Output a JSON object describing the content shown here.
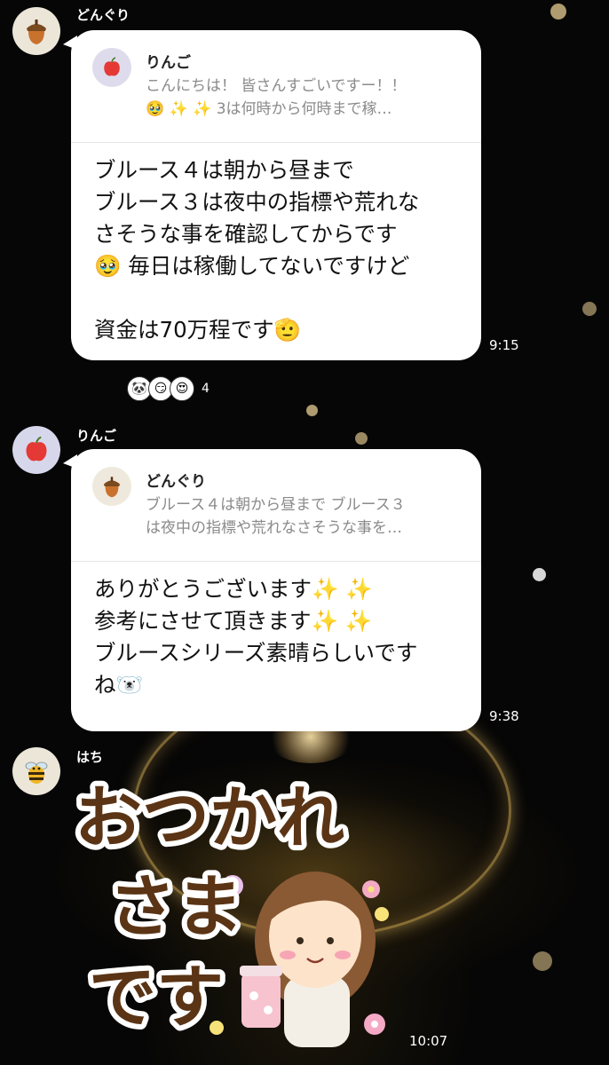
{
  "messages": [
    {
      "sender": "どんぐり",
      "reply_to": {
        "sender": "りんご",
        "line1": "こんにちは！ 皆さんすごいですー！！",
        "line2": "🥹 ✨ ✨ 3は何時から何時まで稼…"
      },
      "lines": [
        "ブルース４は朝から昼まで",
        "ブルース３は夜中の指標や荒れな",
        "さそうな事を確認してからです",
        "🥹 毎日は稼働してないですけど",
        "",
        "資金は70万程です🫡"
      ],
      "time": "9:15",
      "reactions": {
        "count": "4",
        "icons": [
          "panda-face",
          "smirk-face",
          "heart-eyes-face"
        ]
      }
    },
    {
      "sender": "りんご",
      "reply_to": {
        "sender": "どんぐり",
        "line1": "ブルース４は朝から昼まで ブルース３",
        "line2": "は夜中の指標や荒れなさそうな事を…"
      },
      "lines": [
        "ありがとうございます✨ ✨",
        "参考にさせて頂きます✨ ✨",
        "ブルースシリーズ素晴らしいです",
        "ね🐻‍❄️"
      ],
      "time": "9:38"
    },
    {
      "sender": "はち",
      "sticker": {
        "line1": "おつかれ",
        "line2": "さま",
        "line3": "です"
      },
      "time": "10:07"
    }
  ],
  "colors": {
    "bubble": "#ffffff",
    "background": "#070707",
    "sticker_text": "#5a3415",
    "reply_text": "#8a8a8a"
  }
}
